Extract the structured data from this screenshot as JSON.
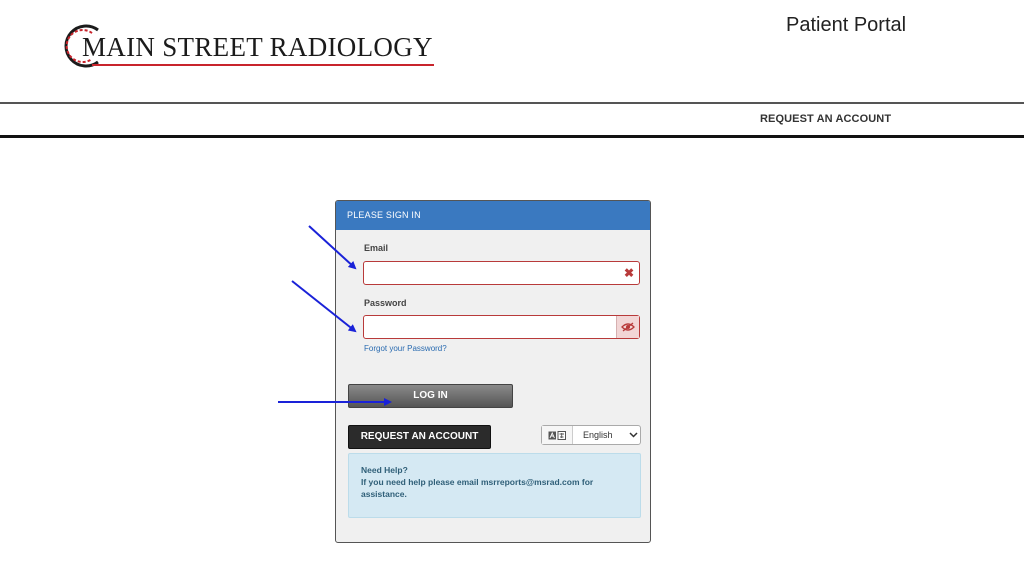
{
  "header": {
    "logo_text": "MAIN STREET RADIOLOGY",
    "portal_title": "Patient Portal",
    "nav_request_account": "REQUEST AN ACCOUNT"
  },
  "login": {
    "panel_title": "PLEASE SIGN IN",
    "email_label": "Email",
    "email_value": "",
    "password_label": "Password",
    "password_value": "",
    "forgot_password": "Forgot your Password?",
    "login_button": "LOG IN",
    "request_button": "REQUEST AN ACCOUNT",
    "language": "English",
    "help_title": "Need Help?",
    "help_text": "If you need help please email msrreports@msrad.com for assistance."
  },
  "colors": {
    "header_blue": "#3a79c0",
    "error_red": "#b83a3a",
    "brand_red": "#c8242c",
    "arrow_blue": "#1a22d8"
  }
}
